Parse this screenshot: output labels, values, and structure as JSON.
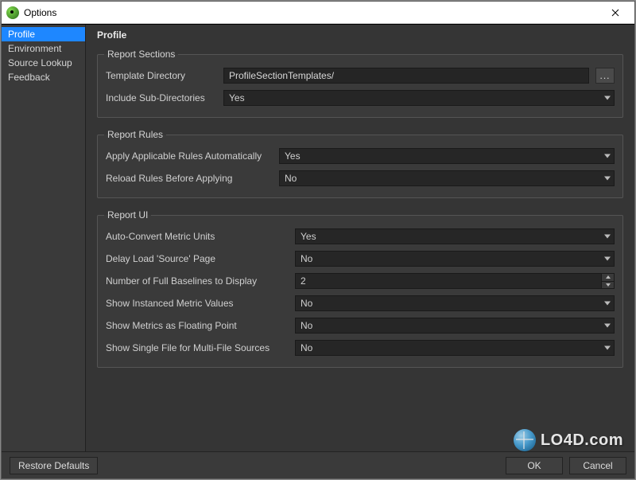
{
  "window": {
    "title": "Options"
  },
  "sidebar": {
    "items": [
      {
        "label": "Profile",
        "selected": true
      },
      {
        "label": "Environment",
        "selected": false
      },
      {
        "label": "Source Lookup",
        "selected": false
      },
      {
        "label": "Feedback",
        "selected": false
      }
    ]
  },
  "main": {
    "heading": "Profile",
    "sections": {
      "reportSections": {
        "title": "Report Sections",
        "templateDirectory": {
          "label": "Template Directory",
          "value": "ProfileSectionTemplates/",
          "browse": "..."
        },
        "includeSubDirs": {
          "label": "Include Sub-Directories",
          "value": "Yes"
        }
      },
      "reportRules": {
        "title": "Report Rules",
        "applyAuto": {
          "label": "Apply Applicable Rules Automatically",
          "value": "Yes"
        },
        "reloadRules": {
          "label": "Reload Rules Before Applying",
          "value": "No"
        }
      },
      "reportUI": {
        "title": "Report UI",
        "autoConvert": {
          "label": "Auto-Convert Metric Units",
          "value": "Yes"
        },
        "delayLoad": {
          "label": "Delay Load 'Source' Page",
          "value": "No"
        },
        "numBaselines": {
          "label": "Number of Full Baselines to Display",
          "value": "2"
        },
        "showInstanced": {
          "label": "Show Instanced Metric Values",
          "value": "No"
        },
        "showFloat": {
          "label": "Show Metrics as Floating Point",
          "value": "No"
        },
        "showSingleFile": {
          "label": "Show Single File for Multi-File Sources",
          "value": "No"
        }
      }
    }
  },
  "footer": {
    "restore": "Restore Defaults",
    "ok": "OK",
    "cancel": "Cancel"
  },
  "watermark": "LO4D.com"
}
